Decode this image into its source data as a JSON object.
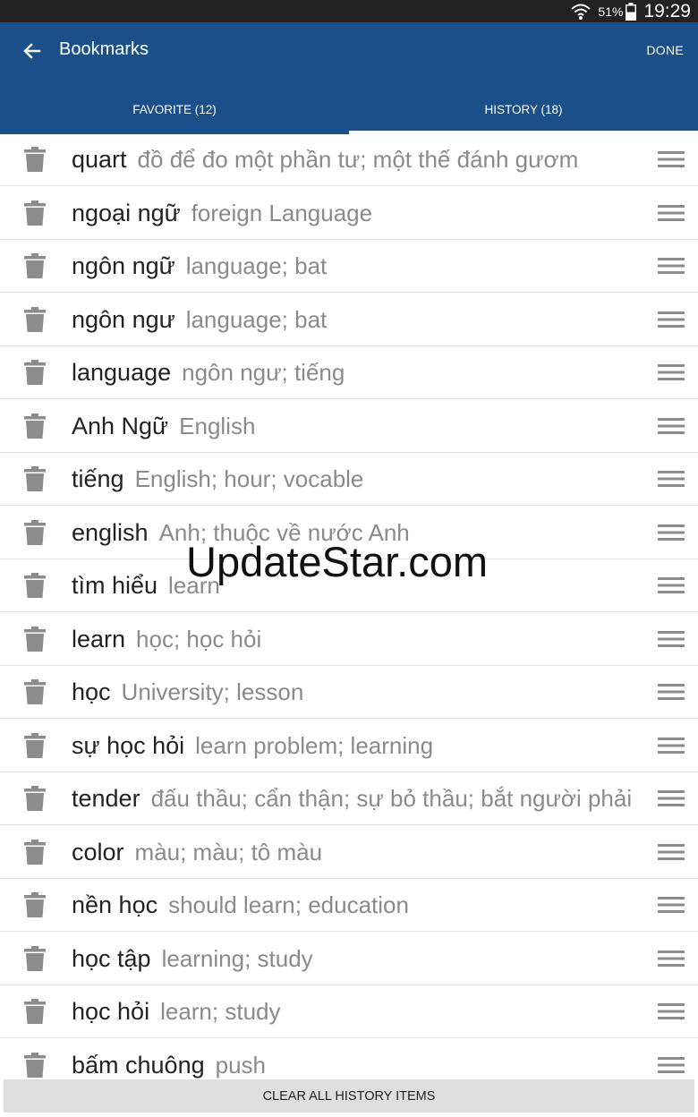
{
  "status_bar": {
    "battery_percent": "51%",
    "time": "19:29"
  },
  "app_bar": {
    "title": "Bookmarks",
    "done_label": "DONE"
  },
  "tabs": [
    {
      "label": "FAVORITE (12)",
      "active": false
    },
    {
      "label": "HISTORY (18)",
      "active": true
    }
  ],
  "history_items": [
    {
      "word": "quart",
      "meaning": "đồ để đo một phần tư; một thế đánh gươm"
    },
    {
      "word": "ngoại ngữ",
      "meaning": "foreign Language"
    },
    {
      "word": "ngôn ngữ",
      "meaning": "language; bat"
    },
    {
      "word": "ngôn ngư",
      "meaning": "language; bat"
    },
    {
      "word": "language",
      "meaning": "ngôn ngư; tiếng"
    },
    {
      "word": "Anh Ngữ",
      "meaning": "English"
    },
    {
      "word": "tiếng",
      "meaning": "English; hour; vocable"
    },
    {
      "word": "english",
      "meaning": "Anh; thuộc về nước Anh"
    },
    {
      "word": "tìm hiểu",
      "meaning": "learn"
    },
    {
      "word": "learn",
      "meaning": "học; học hỏi"
    },
    {
      "word": "học",
      "meaning": "University; lesson"
    },
    {
      "word": "sự học hỏi",
      "meaning": "learn problem; learning"
    },
    {
      "word": "tender",
      "meaning": "đấu thầu; cẩn thận; sự bỏ thầu; bắt người phải"
    },
    {
      "word": "color",
      "meaning": "màu; màu; tô màu"
    },
    {
      "word": "nền học",
      "meaning": "should learn; education"
    },
    {
      "word": "học tập",
      "meaning": "learning; study"
    },
    {
      "word": "học hỏi",
      "meaning": "learn; study"
    },
    {
      "word": "bấm chuông",
      "meaning": "push"
    }
  ],
  "watermark": "UpdateStar.com",
  "clear_button_label": "CLEAR ALL HISTORY ITEMS",
  "colors": {
    "app_bar": "#1b4f8a",
    "status_bar": "#222222",
    "clear_button": "#dedede"
  }
}
